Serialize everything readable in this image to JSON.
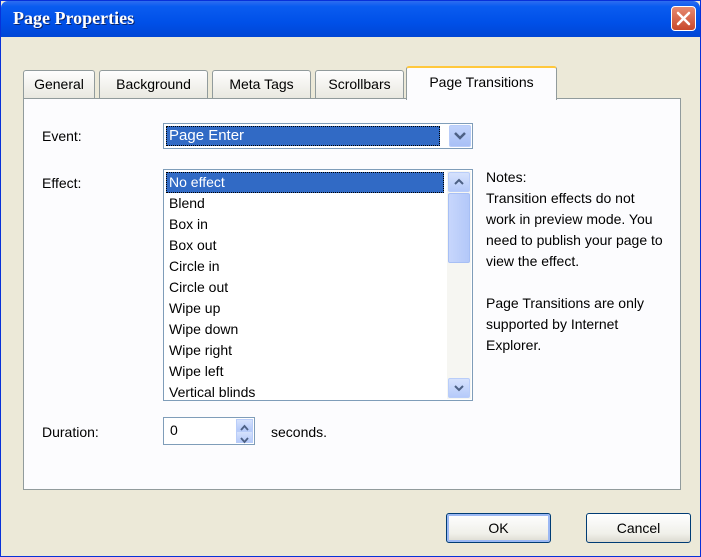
{
  "window": {
    "title": "Page Properties"
  },
  "tabs": [
    "General",
    "Background",
    "Meta Tags",
    "Scrollbars",
    "Page Transitions"
  ],
  "active_tab": "Page Transitions",
  "event": {
    "label": "Event:",
    "value": "Page Enter"
  },
  "effect": {
    "label": "Effect:",
    "items": [
      "No effect",
      "Blend",
      "Box in",
      "Box out",
      "Circle in",
      "Circle out",
      "Wipe up",
      "Wipe down",
      "Wipe right",
      "Wipe left",
      "Vertical blinds"
    ],
    "selected": "No effect"
  },
  "notes": {
    "title": "Notes:",
    "para1": "Transition effects do not work in preview mode. You need to publish your page to view the effect.",
    "para2": "Page Transitions are only supported by Internet Explorer."
  },
  "duration": {
    "label": "Duration:",
    "value": "0",
    "unit": "seconds."
  },
  "buttons": {
    "ok": "OK",
    "cancel": "Cancel"
  },
  "colors": {
    "titlebar": "#0050e8",
    "selection": "#316ac5",
    "dialog_bg": "#ece9d8",
    "close": "#c8482b"
  }
}
